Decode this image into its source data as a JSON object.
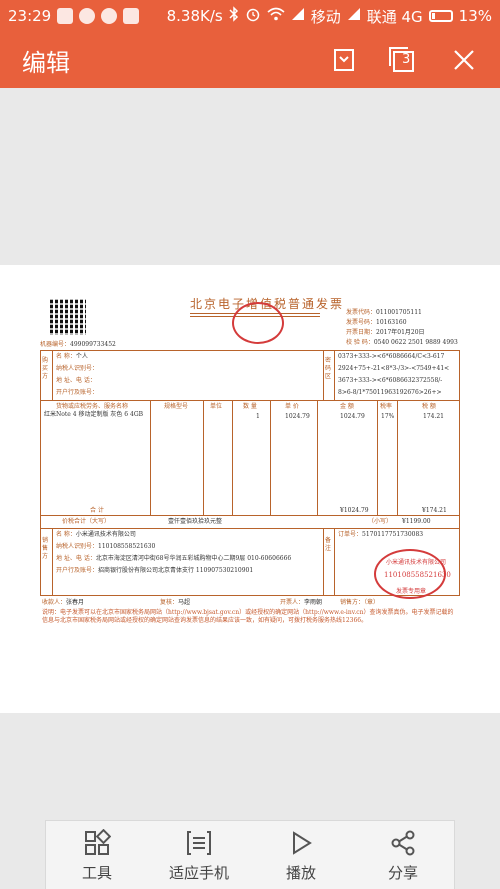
{
  "status": {
    "time": "23:29",
    "speed": "8.38K/s",
    "carrier1": "移动",
    "carrier2": "联通 4G",
    "battery": "13%"
  },
  "appbar": {
    "title": "编辑",
    "tabs_count": "3"
  },
  "invoice": {
    "title": "北京电子增值税普通发票",
    "machine_no_label": "机器编号：",
    "machine_no": "499099733452",
    "code_label": "发票代码：",
    "code": "011001705111",
    "number_label": "发票号码：",
    "number": "10163160",
    "date_label": "开票日期：",
    "date": "2017年01月20日",
    "check_label": "校 验 码：",
    "check": "0540 0622 2501 9889 4993",
    "buyer": {
      "side": "购买方",
      "name_label": "名    称：",
      "name": "个人",
      "tax_label": "纳税人识别号：",
      "addr_label": "地 址、电 话：",
      "bank_label": "开户行及账号："
    },
    "password": {
      "side": "密码区",
      "lines": [
        "0373+333-><6*6086664/C<3-617",
        "2924+75+-21<8*3-/3>-<7549+41<",
        "3673+333-><6*6086632372558/-",
        "8>6-8/1*75011963192676>26+>"
      ]
    },
    "items_header": {
      "name": "货物或应税劳务、服务名称",
      "spec": "规格型号",
      "unit": "单位",
      "qty": "数 量",
      "price": "单 价",
      "amount": "金 额",
      "rate": "税率",
      "tax": "税 额"
    },
    "item": {
      "name": "红米Note 4 移动定制版 灰色 6 4GB",
      "qty": "1",
      "price": "1024.79",
      "amount": "1024.79",
      "rate": "17%",
      "tax": "174.21"
    },
    "subtotal_label": "合    计",
    "subtotal_amount": "¥1024.79",
    "subtotal_tax": "¥174.21",
    "total_label": "价税合计（大写）",
    "total_upper": "壹仟壹佰玖拾玖元整",
    "total_lower_label": "（小写）",
    "total_lower": "¥1199.00",
    "seller": {
      "side": "销售方",
      "name_label": "名    称：",
      "name": "小米通讯技术有限公司",
      "tax_label": "纳税人识别号：",
      "tax_id": "110108558521630",
      "addr_label": "地 址、电 话：",
      "addr": "北京市海淀区清河中街68号华润五彩城购物中心二期9层 010-60606666",
      "bank_label": "开户行及账号：",
      "bank": "招商银行股份有限公司北京青体支行 110907530210901"
    },
    "remark_side": "备注",
    "order_label": "订单号：",
    "order_no": "5170117751730083",
    "payee_label": "收款人：",
    "payee": "张春月",
    "reviewer_label": "复核：",
    "reviewer": "马超",
    "drawer_label": "开票人：",
    "drawer": "李雨朝",
    "seller_stamp_label": "销售方：（章）",
    "stamp_tax_id": "110108558521630",
    "stamp_company": "小米通讯技术有限公司",
    "stamp_type": "发票专用章",
    "footnote": "说明：电子发票可以在北京市国家税务局网站（http://www.bjsat.gov.cn）或经授权的确定网站（http://www.e-inv.cn）查询发票真伪。电子发票记载的信息与北京市国家税务局网站或经授权的确定网站查询发票信息的结果应该一致，如有疑问，可拨打税务服务热线12366。"
  },
  "toolbar": {
    "tools": "工具",
    "fit": "适应手机",
    "play": "播放",
    "share": "分享"
  }
}
